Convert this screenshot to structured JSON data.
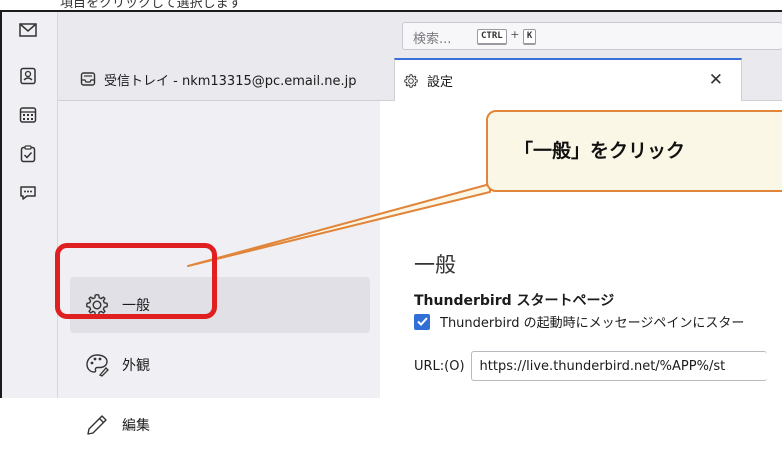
{
  "cut_text": "項目をクリックして選択します",
  "toolbar": {
    "search_placeholder": "検索...",
    "key1": "CTRL",
    "plus": "+",
    "key2": "K"
  },
  "tabs": [
    {
      "label": "受信トレイ - nkm13315@pc.email.ne.jp",
      "icon": "inbox-icon"
    },
    {
      "label": "設定",
      "icon": "gear-icon",
      "close": "✕"
    }
  ],
  "spaces": [
    "mail-icon",
    "address-book-icon",
    "calendar-icon",
    "tasks-icon",
    "chat-icon"
  ],
  "nav": {
    "items": [
      {
        "label": "一般",
        "icon": "gear-icon"
      },
      {
        "label": "外観",
        "icon": "palette-icon"
      },
      {
        "label": "編集",
        "icon": "pencil-icon"
      }
    ]
  },
  "content": {
    "heading": "一般",
    "section_title": "Thunderbird スタートページ",
    "checkbox_label": "Thunderbird の起動時にメッセージペインにスター",
    "checkbox_checked": true,
    "url_label": "URL:(O)",
    "url_value": "https://live.thunderbird.net/%APP%/st"
  },
  "annotation": {
    "callout_text": "「一般」をクリック",
    "callout_border": "#e0853a",
    "highlight_color": "#e02020"
  }
}
